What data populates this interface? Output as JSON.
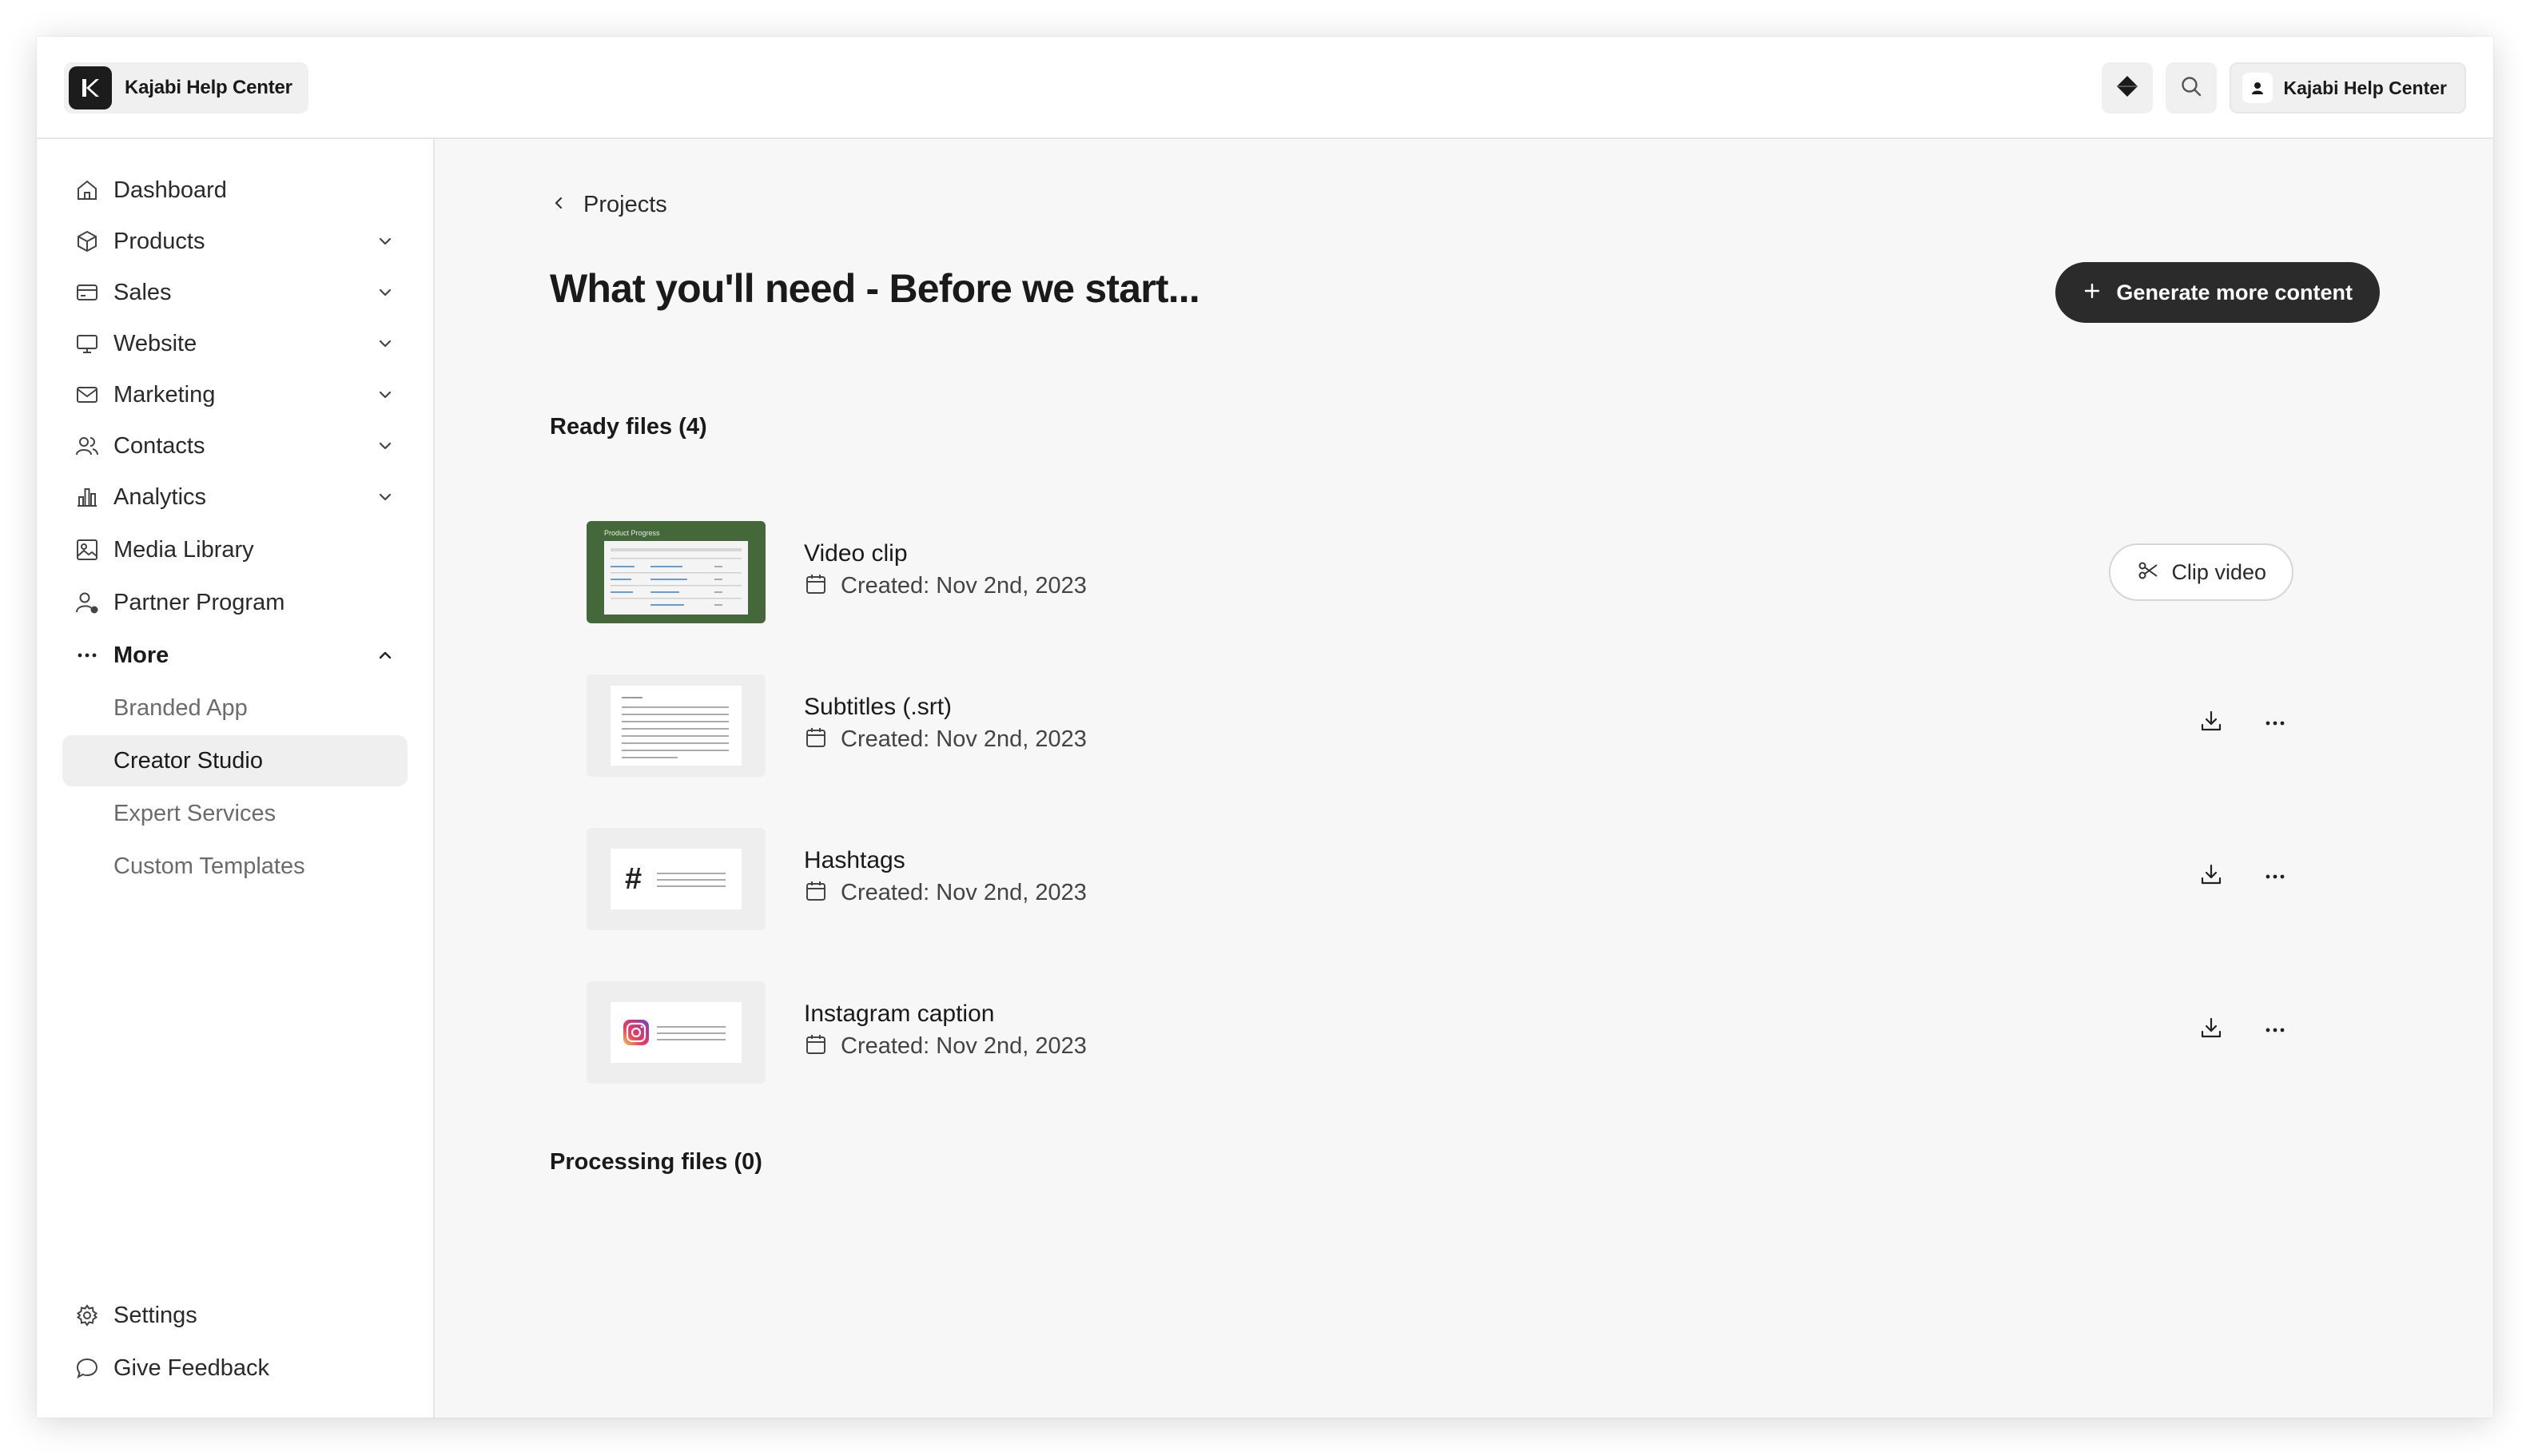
{
  "topbar": {
    "brand_label": "Kajabi Help Center",
    "account_label": "Kajabi Help Center"
  },
  "sidebar": {
    "items": [
      {
        "label": "Dashboard",
        "icon": "home-icon",
        "expandable": false
      },
      {
        "label": "Products",
        "icon": "box-icon",
        "expandable": true
      },
      {
        "label": "Sales",
        "icon": "credit-card-icon",
        "expandable": true
      },
      {
        "label": "Website",
        "icon": "monitor-icon",
        "expandable": true
      },
      {
        "label": "Marketing",
        "icon": "mail-icon",
        "expandable": true
      },
      {
        "label": "Contacts",
        "icon": "users-icon",
        "expandable": true
      },
      {
        "label": "Analytics",
        "icon": "bar-chart-icon",
        "expandable": true
      },
      {
        "label": "Media Library",
        "icon": "image-icon",
        "expandable": false
      },
      {
        "label": "Partner Program",
        "icon": "partner-icon",
        "expandable": false
      },
      {
        "label": "More",
        "icon": "ellipsis-icon",
        "expandable": true,
        "expanded": true
      }
    ],
    "more_items": [
      {
        "label": "Branded App",
        "active": false
      },
      {
        "label": "Creator Studio",
        "active": true
      },
      {
        "label": "Expert Services",
        "active": false
      },
      {
        "label": "Custom Templates",
        "active": false
      }
    ],
    "footer_items": [
      {
        "label": "Settings",
        "icon": "gear-icon"
      },
      {
        "label": "Give Feedback",
        "icon": "chat-bubble-icon"
      }
    ]
  },
  "main": {
    "breadcrumb": "Projects",
    "title": "What you'll need - Before we start...",
    "generate_button": "Generate more content",
    "ready_section": "Ready files (4)",
    "processing_section": "Processing files (0)",
    "thumb_video_caption": "Product Progress",
    "files": [
      {
        "name": "Video clip",
        "created": "Created: Nov 2nd, 2023",
        "action": "Clip video"
      },
      {
        "name": "Subtitles (.srt)",
        "created": "Created: Nov 2nd, 2023"
      },
      {
        "name": "Hashtags",
        "created": "Created: Nov 2nd, 2023"
      },
      {
        "name": "Instagram caption",
        "created": "Created: Nov 2nd, 2023"
      }
    ]
  },
  "colors": {
    "primary_button": "#2b2b2b",
    "video_thumb": "#44683a",
    "active_nav": "#efefef"
  }
}
